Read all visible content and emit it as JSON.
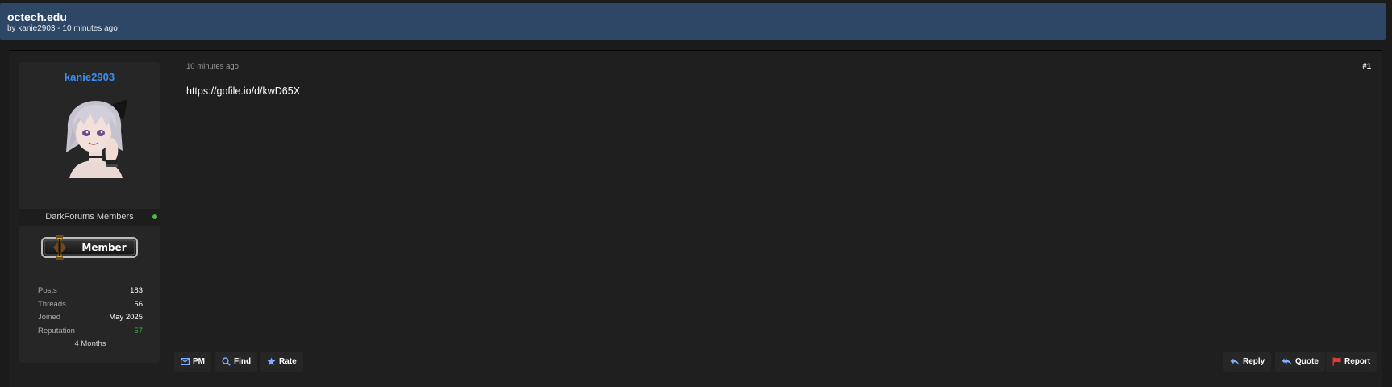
{
  "thread": {
    "title": "octech.edu",
    "subtitle": "by kanie2903 - 10 minutes ago"
  },
  "user": {
    "username": "kanie2903",
    "avatar_icon": "anime-avatar-icon",
    "usergroup": "DarkForums Members",
    "online": true,
    "rank": "Member",
    "stats": [
      {
        "label": "Posts",
        "value": "183"
      },
      {
        "label": "Threads",
        "value": "56"
      },
      {
        "label": "Joined",
        "value": "May 2025"
      },
      {
        "label": "Reputation",
        "value": "57"
      }
    ],
    "membership_duration": "4 Months"
  },
  "post": {
    "date": "10 minutes ago",
    "number": "#1",
    "content": "https://gofile.io/d/kwD65X"
  },
  "actions": {
    "pm": {
      "label": "PM",
      "icon": "envelope-icon"
    },
    "find": {
      "label": "Find",
      "icon": "search-icon"
    },
    "rate": {
      "label": "Rate",
      "icon": "star-icon"
    },
    "reply": {
      "label": "Reply",
      "icon": "reply-icon"
    },
    "quote": {
      "label": "Quote",
      "icon": "quote-icon"
    },
    "report": {
      "label": "Report",
      "icon": "flag-icon"
    }
  },
  "colors": {
    "header_bg": "#2e4766",
    "username": "#3d8df5",
    "online": "#4cbb3e",
    "reputation": "#3eb13e",
    "report_flag": "#e23b3b"
  }
}
